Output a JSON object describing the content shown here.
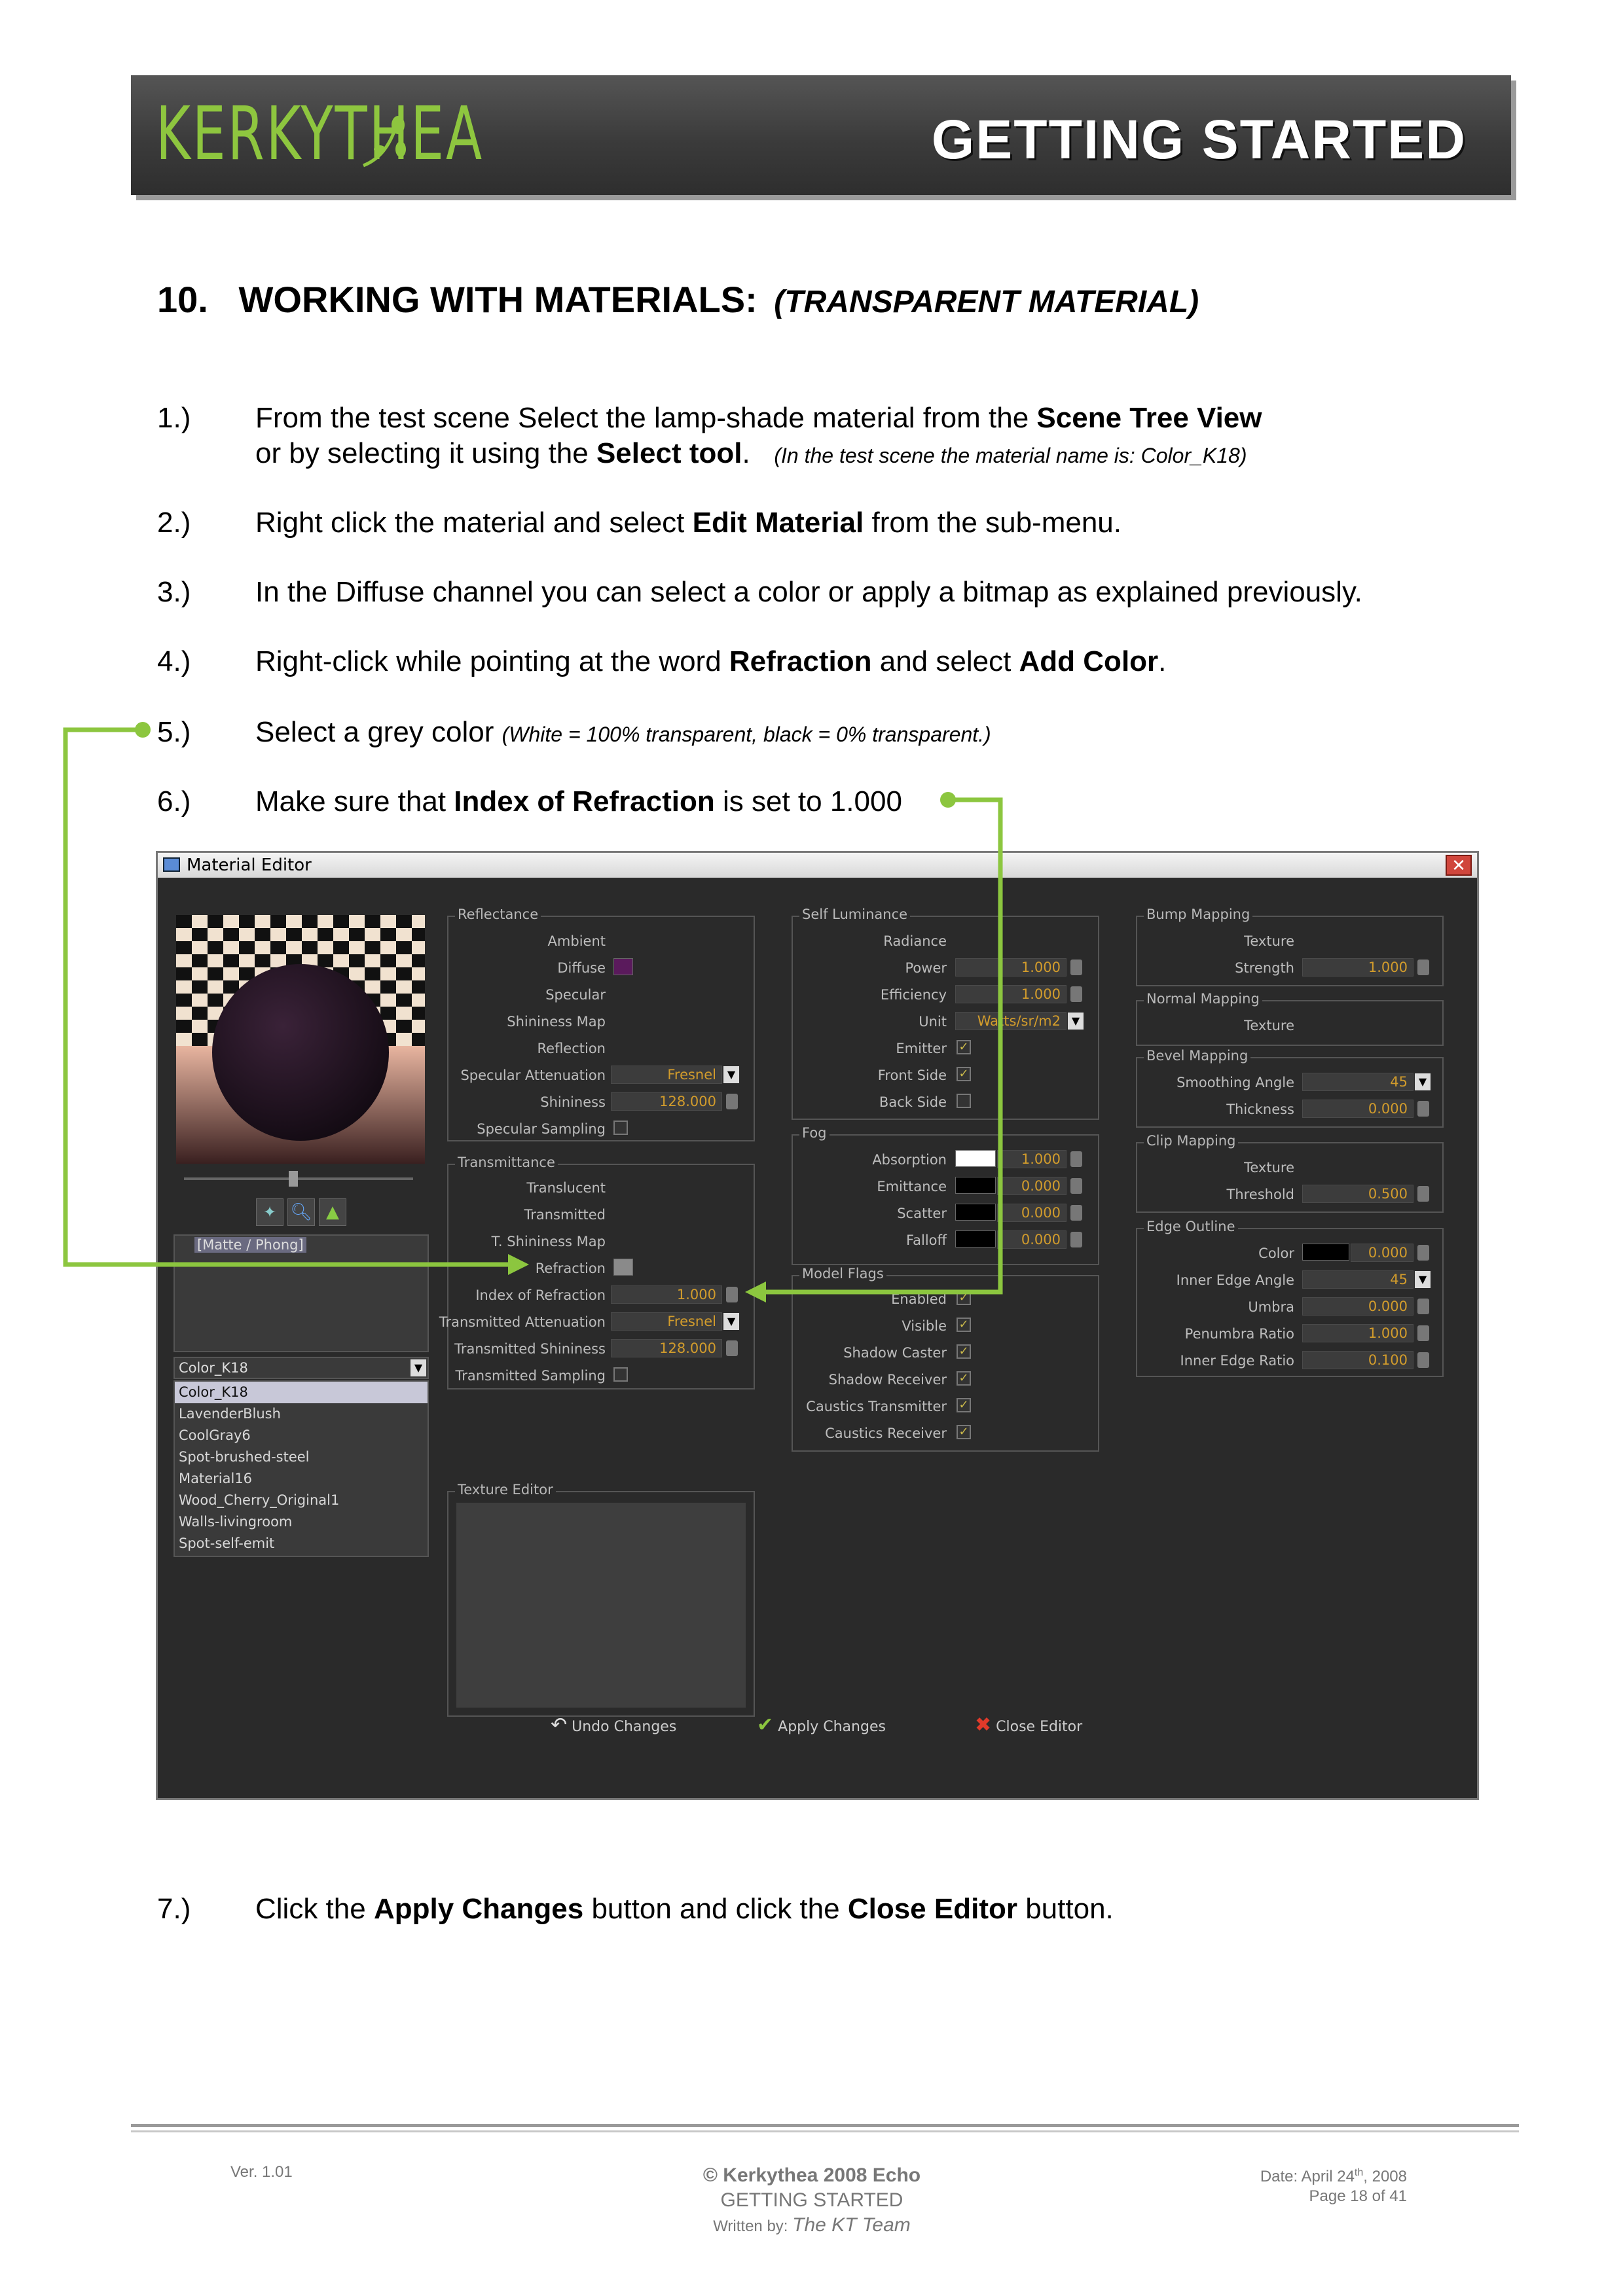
{
  "header": {
    "logo_text": "KERKYTHEA",
    "title": "GETTING STARTED"
  },
  "heading": {
    "number": "10.",
    "title": "WORKING WITH MATERIALS:",
    "subtitle": "(TRANSPARENT MATERIAL)"
  },
  "steps": [
    {
      "num": "1.)",
      "line1_a": "From the test scene Select the lamp-shade material from the ",
      "line1_b": "Scene Tree View",
      "line2_a": "or by selecting it using the ",
      "line2_b": "Select tool",
      "line2_c": ".",
      "line2_note": "(In the test scene the material name is: Color_K18)"
    },
    {
      "num": "2.)",
      "a": "Right click the material and select ",
      "b": "Edit Material",
      "c": " from the sub-menu."
    },
    {
      "num": "3.)",
      "a": "In the Diffuse channel you can select a color or apply a bitmap as explained previously."
    },
    {
      "num": "4.)",
      "a": "Right-click while pointing at the word ",
      "b": "Refraction",
      "c": " and select ",
      "d": "Add Color",
      "e": "."
    },
    {
      "num": "5.)",
      "a": "Select a grey color ",
      "note": "(White = 100% transparent, black = 0% transparent.)"
    },
    {
      "num": "6.)",
      "a": "Make sure that ",
      "b": "Index of Refraction",
      "c": " is set to 1.000"
    },
    {
      "num": "7.)",
      "a": "Click the ",
      "b": "Apply Changes",
      "c": " button and click the ",
      "d": "Close Editor",
      "e": " button."
    }
  ],
  "editor": {
    "title": "Material Editor",
    "tree_label": "[Matte / Phong]",
    "material_select": "Color_K18",
    "materials": [
      "Color_K18",
      "LavenderBlush",
      "CoolGray6",
      "Spot-brushed-steel",
      "Material16",
      "Wood_Cherry_Original1",
      "Walls-livingroom",
      "Spot-self-emit"
    ],
    "reflectance": {
      "title": "Reflectance",
      "ambient": "Ambient",
      "diffuse": "Diffuse",
      "specular": "Specular",
      "shininess_map": "Shininess Map",
      "reflection": "Reflection",
      "spec_att": "Specular Attenuation",
      "spec_att_val": "Fresnel",
      "shininess": "Shininess",
      "shininess_val": "128.000",
      "spec_sampling": "Specular Sampling"
    },
    "transmittance": {
      "title": "Transmittance",
      "translucent": "Translucent",
      "transmitted": "Transmitted",
      "t_shininess_map": "T. Shininess Map",
      "refraction": "Refraction",
      "ior": "Index of Refraction",
      "ior_val": "1.000",
      "trans_att": "Transmitted Attenuation",
      "trans_att_val": "Fresnel",
      "trans_shin": "Transmitted Shininess",
      "trans_shin_val": "128.000",
      "trans_sampling": "Transmitted Sampling"
    },
    "texture_editor": "Texture Editor",
    "self_lum": {
      "title": "Self Luminance",
      "radiance": "Radiance",
      "power": "Power",
      "power_val": "1.000",
      "efficiency": "Efficiency",
      "efficiency_val": "1.000",
      "unit": "Unit",
      "unit_val": "Watts/sr/m2",
      "emitter": "Emitter",
      "front": "Front Side",
      "back": "Back Side"
    },
    "fog": {
      "title": "Fog",
      "absorption": "Absorption",
      "absorption_val": "1.000",
      "emittance": "Emittance",
      "emittance_val": "0.000",
      "scatter": "Scatter",
      "scatter_val": "0.000",
      "falloff": "Falloff",
      "falloff_val": "0.000"
    },
    "flags": {
      "title": "Model Flags",
      "enabled": "Enabled",
      "visible": "Visible",
      "shadow_caster": "Shadow Caster",
      "shadow_receiver": "Shadow Receiver",
      "caustics_tx": "Caustics Transmitter",
      "caustics_rx": "Caustics Receiver"
    },
    "bump": {
      "title": "Bump Mapping",
      "texture": "Texture",
      "strength": "Strength",
      "strength_val": "1.000"
    },
    "normal": {
      "title": "Normal Mapping",
      "texture": "Texture"
    },
    "bevel": {
      "title": "Bevel Mapping",
      "angle": "Smoothing Angle",
      "angle_val": "45",
      "thickness": "Thickness",
      "thickness_val": "0.000"
    },
    "clip": {
      "title": "Clip Mapping",
      "texture": "Texture",
      "threshold": "Threshold",
      "threshold_val": "0.500"
    },
    "edge": {
      "title": "Edge Outline",
      "color": "Color",
      "color_val": "0.000",
      "inner_angle": "Inner Edge Angle",
      "inner_angle_val": "45",
      "umbra": "Umbra",
      "umbra_val": "0.000",
      "penumbra": "Penumbra Ratio",
      "penumbra_val": "1.000",
      "inner_ratio": "Inner Edge Ratio",
      "inner_ratio_val": "0.100"
    },
    "buttons": {
      "undo": "Undo Changes",
      "apply": "Apply Changes",
      "close": "Close Editor"
    },
    "colors": {
      "diffuse_swatch": "#5a1a5c",
      "refraction_swatch": "#8a8a8a",
      "arrow": "#8cc63f"
    }
  },
  "footer": {
    "version": "Ver. 1.01",
    "copyright": "© Kerkythea 2008 Echo",
    "doc": "GETTING STARTED",
    "written_by": "Written by:",
    "team": "The KT Team",
    "date_a": "Date: April 24",
    "date_sup": "th",
    "date_b": ", 2008",
    "page": "Page 18 of 41"
  }
}
